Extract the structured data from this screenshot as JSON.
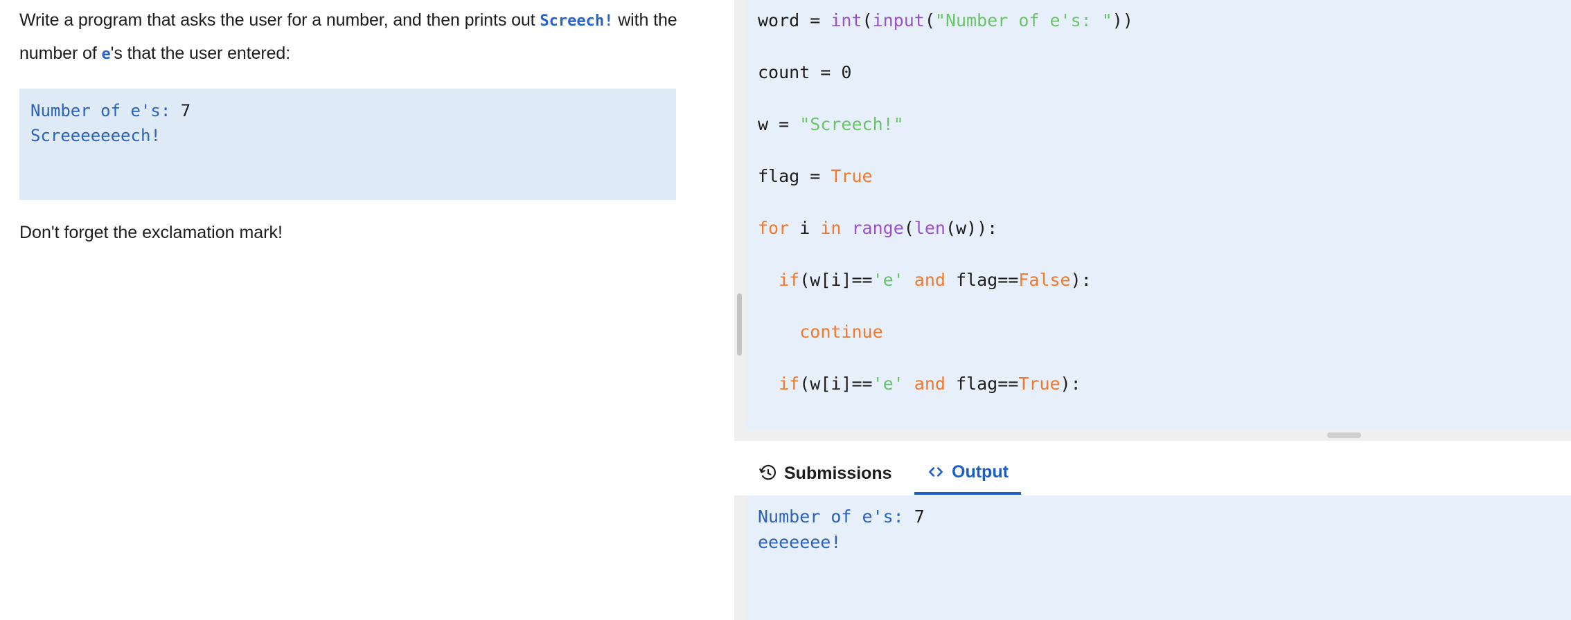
{
  "problem": {
    "statement_part1": "Write a program that asks the user for a number, and then prints out",
    "statement_code": "Screech!",
    "statement_part2": " with the number of ",
    "statement_code_e": "e",
    "statement_part3": "'s that the user entered:",
    "sample_output_line1_label": "Number of e's: ",
    "sample_output_line1_value": "7",
    "sample_output_line2": "Screeeeeeech!",
    "note": "Don't forget the exclamation mark!"
  },
  "editor": {
    "lines": [
      [
        {
          "t": "word = ",
          "c": "plain"
        },
        {
          "t": "int",
          "c": "fn"
        },
        {
          "t": "(",
          "c": "plain"
        },
        {
          "t": "input",
          "c": "fn"
        },
        {
          "t": "(",
          "c": "plain"
        },
        {
          "t": "\"Number of e's: \"",
          "c": "str"
        },
        {
          "t": "))",
          "c": "plain"
        }
      ],
      [
        {
          "t": "count = 0",
          "c": "plain"
        }
      ],
      [
        {
          "t": "w = ",
          "c": "plain"
        },
        {
          "t": "\"Screech!\"",
          "c": "str"
        }
      ],
      [
        {
          "t": "flag = ",
          "c": "plain"
        },
        {
          "t": "True",
          "c": "bool"
        }
      ],
      [
        {
          "t": "for",
          "c": "kw"
        },
        {
          "t": " i ",
          "c": "plain"
        },
        {
          "t": "in",
          "c": "kw"
        },
        {
          "t": " ",
          "c": "plain"
        },
        {
          "t": "range",
          "c": "fn"
        },
        {
          "t": "(",
          "c": "plain"
        },
        {
          "t": "len",
          "c": "fn"
        },
        {
          "t": "(w)):",
          "c": "plain"
        }
      ],
      [
        {
          "t": "  ",
          "c": "plain"
        },
        {
          "t": "if",
          "c": "kw"
        },
        {
          "t": "(w[i]==",
          "c": "plain"
        },
        {
          "t": "'e'",
          "c": "str"
        },
        {
          "t": " ",
          "c": "plain"
        },
        {
          "t": "and",
          "c": "kw"
        },
        {
          "t": " flag==",
          "c": "plain"
        },
        {
          "t": "False",
          "c": "bool"
        },
        {
          "t": "):",
          "c": "plain"
        }
      ],
      [
        {
          "t": "    ",
          "c": "plain"
        },
        {
          "t": "continue",
          "c": "kw"
        }
      ],
      [
        {
          "t": "  ",
          "c": "plain"
        },
        {
          "t": "if",
          "c": "kw"
        },
        {
          "t": "(w[i]==",
          "c": "plain"
        },
        {
          "t": "'e'",
          "c": "str"
        },
        {
          "t": " ",
          "c": "plain"
        },
        {
          "t": "and",
          "c": "kw"
        },
        {
          "t": " flag==",
          "c": "plain"
        },
        {
          "t": "True",
          "c": "bool"
        },
        {
          "t": "):",
          "c": "plain"
        }
      ]
    ]
  },
  "tabs": {
    "submissions_label": "Submissions",
    "submissions_icon": "history-clock-icon",
    "output_label": "Output",
    "output_icon": "code-brackets-icon",
    "active": "Output"
  },
  "output": {
    "line1_label": "Number of e's: ",
    "line1_value": "7",
    "line2": "eeeeeee!"
  },
  "colors": {
    "accent_blue": "#1a5fc4",
    "code_bg": "#e7f0fa",
    "sample_bg": "#dfeaf7",
    "output_text": "#2b62bb",
    "keyword_orange": "#f2792b",
    "string_green": "#6ac36a",
    "function_purple": "#9b52c9"
  }
}
